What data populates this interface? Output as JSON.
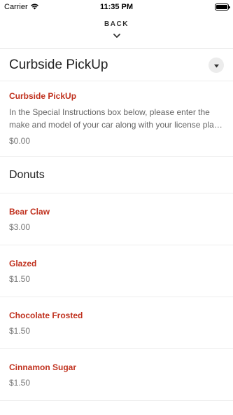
{
  "status_bar": {
    "carrier": "Carrier",
    "time": "11:35 PM"
  },
  "nav": {
    "back_label": "BACK"
  },
  "section": {
    "title": "Curbside PickUp"
  },
  "curbside_item": {
    "name": "Curbside PickUp",
    "description": "In the Special Instructions box below, please enter the make and model of your car along with your license plate number.",
    "price": "$0.00"
  },
  "category": {
    "title": "Donuts"
  },
  "items": [
    {
      "name": "Bear Claw",
      "price": "$3.00"
    },
    {
      "name": "Glazed",
      "price": "$1.50"
    },
    {
      "name": "Chocolate Frosted",
      "price": "$1.50"
    },
    {
      "name": "Cinnamon Sugar",
      "price": "$1.50"
    }
  ],
  "colors": {
    "accent": "#c0311e"
  },
  "icons": {
    "wifi": "wifi-icon",
    "battery": "battery-icon",
    "back": "chevron-down-icon",
    "dropdown": "caret-down-icon"
  }
}
